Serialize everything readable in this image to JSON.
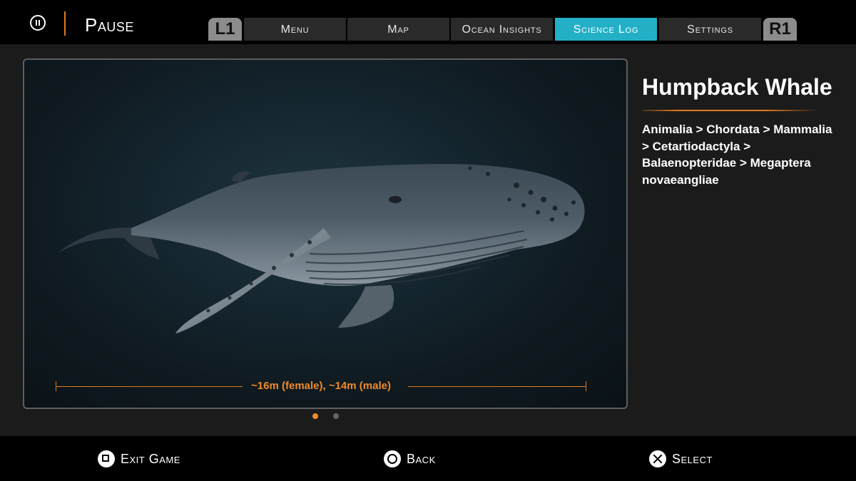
{
  "header": {
    "title": "Pause",
    "pause_icon": "pause-circle-icon",
    "left_shoulder": "L1",
    "right_shoulder": "R1",
    "tabs": [
      {
        "label": "Menu",
        "active": false
      },
      {
        "label": "Map",
        "active": false
      },
      {
        "label": "Ocean Insights",
        "active": false
      },
      {
        "label": "Science Log",
        "active": true
      },
      {
        "label": "Settings",
        "active": false
      }
    ]
  },
  "species": {
    "name": "Humpback Whale",
    "taxonomy": "Animalia > Chordata > Mammalia > Cetartiodactyla > Balaenopteridae > Megaptera novaeangliae",
    "size_label": "~16m (female), ~14m (male)"
  },
  "gallery": {
    "page_count": 2,
    "current_page": 1
  },
  "footer": {
    "buttons": [
      {
        "glyph": "square-button-icon",
        "label": "Exit Game"
      },
      {
        "glyph": "circle-button-icon",
        "label": "Back"
      },
      {
        "glyph": "cross-button-icon",
        "label": "Select"
      }
    ]
  },
  "colors": {
    "accent_orange": "#e07a1f",
    "active_tab": "#23b0c6",
    "background": "#1b1b1b",
    "bar": "#000000"
  }
}
